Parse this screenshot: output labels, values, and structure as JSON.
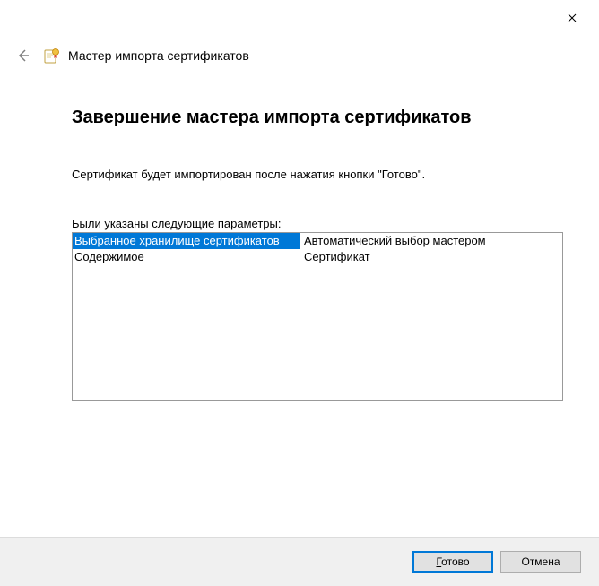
{
  "header": {
    "wizard_title": "Мастер импорта сертификатов"
  },
  "main": {
    "heading": "Завершение мастера импорта сертификатов",
    "instruction": "Сертификат будет импортирован после нажатия кнопки \"Готово\".",
    "params_label": "Были указаны следующие параметры:",
    "rows": [
      {
        "key": "Выбранное хранилище сертификатов",
        "value": "Автоматический выбор мастером"
      },
      {
        "key": "Содержимое",
        "value": "Сертификат"
      }
    ]
  },
  "footer": {
    "finish_prefix": "Г",
    "finish_rest": "отово",
    "cancel": "Отмена"
  }
}
